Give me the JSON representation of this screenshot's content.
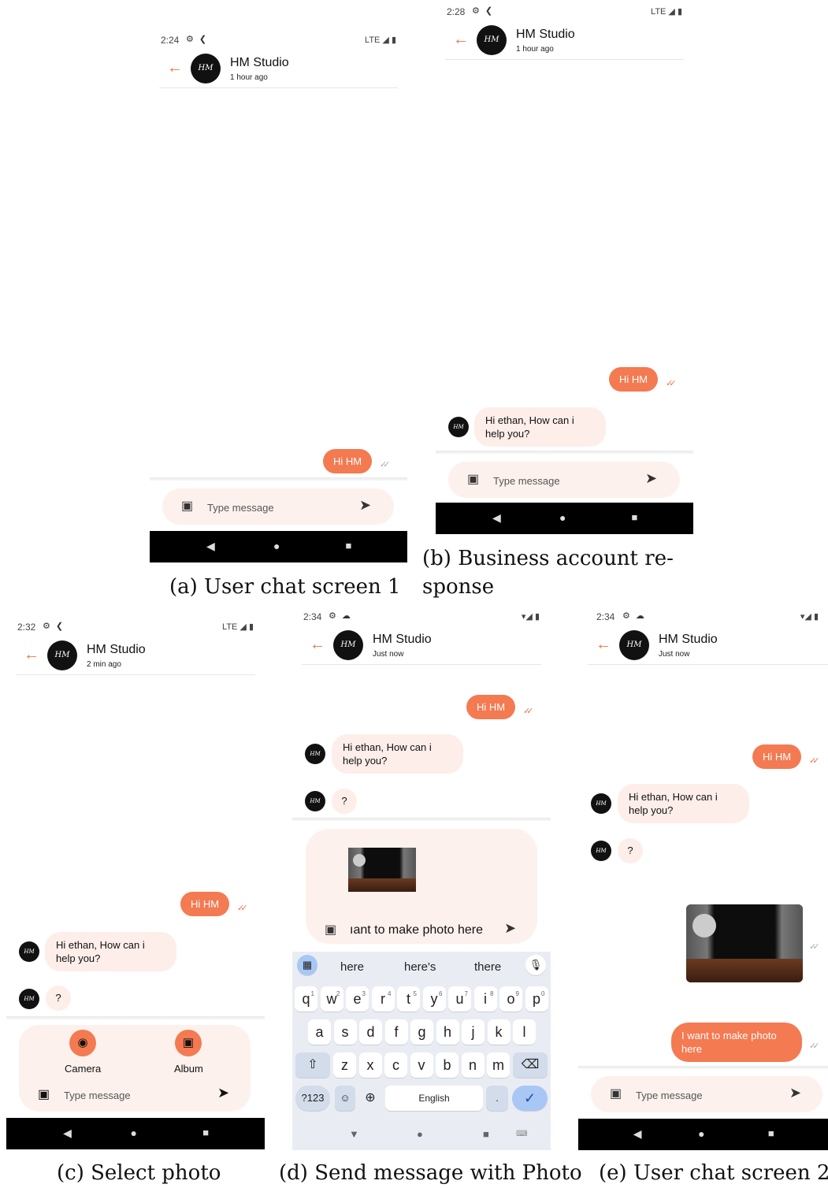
{
  "contact": {
    "name": "HM Studio",
    "avatar_text": "HM Studio"
  },
  "panels": {
    "a": {
      "time": "2:24",
      "status_right": "LTE ◢ ▮",
      "last_seen": "1 hour ago",
      "caption": "(a)  User chat screen 1"
    },
    "b": {
      "time": "2:28",
      "status_right": "LTE ◢ ▮",
      "last_seen": "1 hour ago",
      "caption_line1": "(b)   Business   account   re-",
      "caption_line2": "sponse"
    },
    "c": {
      "time": "2:32",
      "status_right": "LTE ◢ ▮",
      "last_seen": "2 min ago",
      "caption": "(c)  Select photo"
    },
    "d": {
      "time": "2:34",
      "status_right": "▾◢ ▮",
      "last_seen": "Just now",
      "caption": "(d)  Send message with Photo"
    },
    "e": {
      "time": "2:34",
      "status_right": "▾◢ ▮",
      "last_seen": "Just now",
      "caption": "(e)  User chat screen 2"
    }
  },
  "messages": {
    "hi": "Hi HM",
    "reply": "Hi ethan, How can i help you?",
    "question": "?",
    "photo_caption_typed": "ıant to make photo here",
    "photo_msg": "I want to make photo here"
  },
  "composer": {
    "placeholder": "Type message"
  },
  "picker": {
    "camera": "Camera",
    "album": "Album"
  },
  "keyboard": {
    "suggestions": [
      "here",
      "here's",
      "there"
    ],
    "row1": [
      "q",
      "w",
      "e",
      "r",
      "t",
      "y",
      "u",
      "i",
      "o",
      "p"
    ],
    "row1_digits": [
      "1",
      "2",
      "3",
      "4",
      "5",
      "6",
      "7",
      "8",
      "9",
      "0"
    ],
    "row2": [
      "a",
      "s",
      "d",
      "f",
      "g",
      "h",
      "j",
      "k",
      "l"
    ],
    "row3": [
      "z",
      "x",
      "c",
      "v",
      "b",
      "n",
      "m"
    ],
    "symbols": "?123",
    "space": "English",
    "period": "."
  }
}
